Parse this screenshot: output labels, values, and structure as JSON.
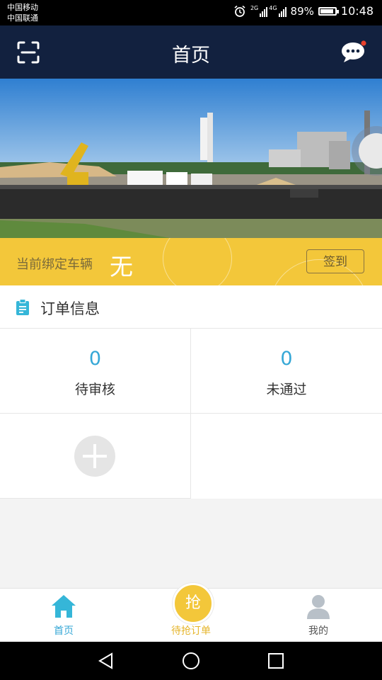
{
  "status_bar": {
    "carrier_1": "中国移动",
    "carrier_2": "中国联通",
    "net_1": "2G",
    "net_2": "4G",
    "battery": "89%",
    "battery_level": 0.89,
    "time": "10:48",
    "icons": [
      "alarm-icon",
      "signal-icon",
      "battery-icon"
    ]
  },
  "header": {
    "title": "首页",
    "left_icon": "scan-icon",
    "right_icon": "chat-icon",
    "background": "#12213f",
    "has_notification_dot": true
  },
  "vehicle": {
    "label": "当前绑定车辆",
    "value": "无",
    "checkin_label": "签到",
    "background": "#f3c73a"
  },
  "orders": {
    "title": "订单信息",
    "icon": "clipboard-icon",
    "items": [
      {
        "count": "0",
        "label": "待审核"
      },
      {
        "count": "0",
        "label": "未通过"
      }
    ],
    "add_icon": "plus-icon",
    "accent": "#35a7d6"
  },
  "tabs": [
    {
      "label": "首页",
      "icon": "home-icon",
      "active": true,
      "color": "#35a7d6"
    },
    {
      "label": "待抢订单",
      "icon": "grab-icon",
      "glyph": "抢",
      "active": false,
      "color": "#e5b52b"
    },
    {
      "label": "我的",
      "icon": "user-icon",
      "active": false,
      "color": "#888888"
    }
  ],
  "system_nav": [
    "back-icon",
    "home-circle-icon",
    "recents-icon"
  ]
}
